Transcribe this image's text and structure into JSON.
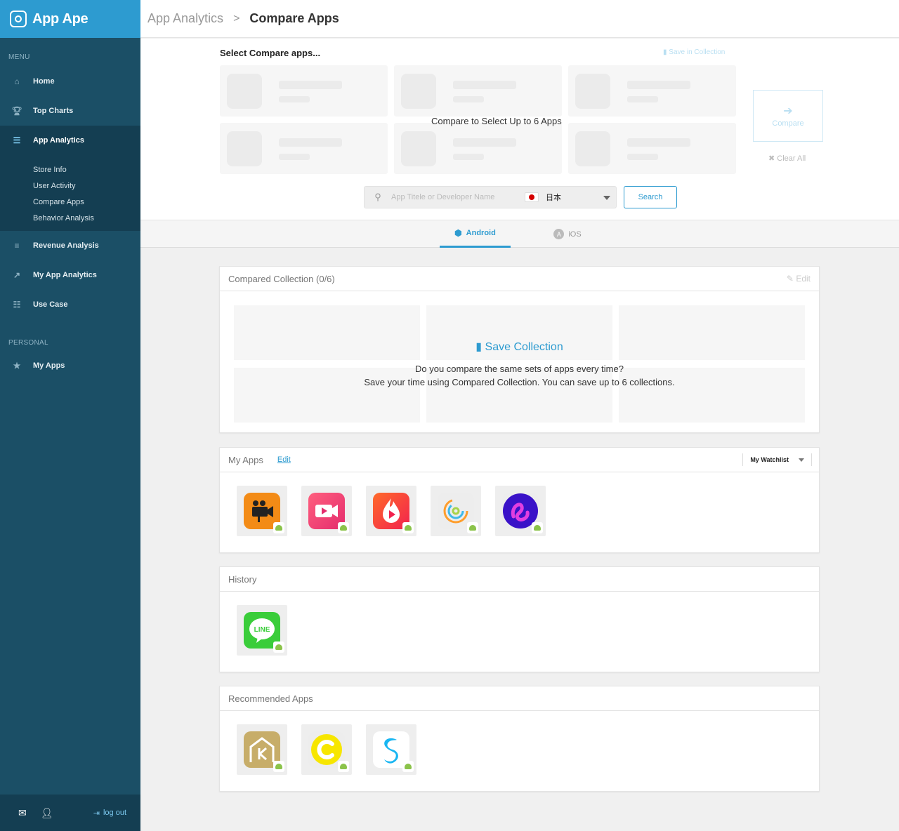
{
  "brand": {
    "name": "App Ape"
  },
  "sidebar": {
    "menu_label": "MENU",
    "personal_label": "PERSONAL",
    "items": [
      {
        "label": "Home",
        "icon": "home-icon"
      },
      {
        "label": "Top Charts",
        "icon": "trophy-icon"
      },
      {
        "label": "App Analytics",
        "icon": "sliders-icon"
      },
      {
        "label": "Revenue Analysis",
        "icon": "database-icon"
      },
      {
        "label": "My App Analytics",
        "icon": "line-chart-icon"
      },
      {
        "label": "Use Case",
        "icon": "list-icon"
      }
    ],
    "submenu": [
      "Store Info",
      "User Activity",
      "Compare Apps",
      "Behavior Analysis"
    ],
    "personal_items": [
      {
        "label": "My Apps",
        "icon": "star-icon"
      }
    ],
    "footer": {
      "logout": "log out"
    }
  },
  "header": {
    "crumb_parent": "App Analytics",
    "crumb_current": "Compare Apps"
  },
  "select": {
    "title": "Select Compare apps...",
    "save_in_collection": "Save in Collection",
    "overlay": "Compare to Select Up to 6 Apps",
    "compare_label": "Compare",
    "clear_all": "Clear All",
    "search_placeholder": "App Titele or Developer Name",
    "country": "日本",
    "search_button": "Search"
  },
  "tabs": {
    "android": "Android",
    "ios": "iOS"
  },
  "collection": {
    "title": "Compared Collection (0/6)",
    "edit": "Edit",
    "save_collection": "Save Collection",
    "desc1": "Do you compare the same sets of apps every time?",
    "desc2": "Save your time using Compared Collection. You can save up to 6 collections."
  },
  "myapps": {
    "title": "My Apps",
    "edit": "Edit",
    "watchlist": "My Watchlist"
  },
  "history": {
    "title": "History"
  },
  "recommended": {
    "title": "Recommended Apps"
  },
  "colors": {
    "accent": "#2d9bd0",
    "sidebar": "#1b4f66",
    "logo_bar": "#2d9bd0"
  }
}
